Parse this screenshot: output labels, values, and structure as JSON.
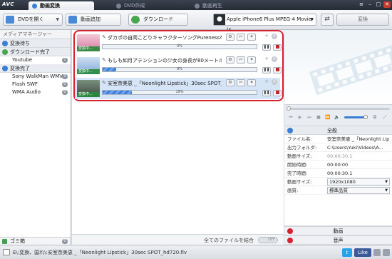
{
  "app": {
    "logo": "AVC"
  },
  "tabs": [
    {
      "label": "動画変換"
    },
    {
      "label": "DVD作成"
    },
    {
      "label": "動画再生"
    }
  ],
  "window_buttons": {
    "settings": "≡",
    "minimize": "–",
    "maximize": "□",
    "close": "✕"
  },
  "toolbar": {
    "open_dvd_label": "DVDを開く",
    "add_video_label": "動画追加",
    "download_label": "ダウンロード",
    "profile_value": "Apple iPhone6 Plus MPEG-4 Movie (*...",
    "convert_label": "変換"
  },
  "sidebar": {
    "header": "メディアマネージャー",
    "groups": [
      {
        "label": "変換待ち",
        "items": []
      },
      {
        "label": "ダウンロード完了",
        "items": [
          {
            "label": "Youtube",
            "count": "1"
          }
        ]
      },
      {
        "label": "変換完了",
        "items": [
          {
            "label": "Sony WalkMan WMV",
            "count": "0"
          },
          {
            "label": "Flash SWF",
            "count": "0"
          },
          {
            "label": "WMA Audio",
            "count": "0"
          }
        ]
      }
    ],
    "trash": {
      "label": "ゴミ箱",
      "count": "0"
    }
  },
  "files": [
    {
      "name": "ダカポの自両こどりキャラクターソングPureness卒...",
      "progress_pct": "0%",
      "progress": 0.0,
      "thumb_label": "変換中..."
    },
    {
      "name": "もしも如月アテンションの少女の身長が80メートル...",
      "progress_pct": "9%",
      "progress": 0.09,
      "thumb_label": "変換中..."
    },
    {
      "name": "安室奈美恵 _「Neonlight Lipstick」30sec SPOT_hd...",
      "progress_pct": "19%",
      "progress": 0.19,
      "thumb_label": "変換中..."
    }
  ],
  "merge": {
    "label": "全てのファイルを結合",
    "toggle": "OFF"
  },
  "properties": {
    "header": "全般",
    "rows": [
      {
        "key": "ファイル名:",
        "value": "安室奈美恵 _「Neonlight Lip"
      },
      {
        "key": "出力フォルダ:",
        "value": "C:\\Users\\Yuki\\Videos\\A..."
      },
      {
        "key": "動画サイズ:",
        "value": "00:00:30.1"
      },
      {
        "key": "開始時間:",
        "value": "00:00:00"
      },
      {
        "key": "完了時間:",
        "value": "00:00:30.1"
      },
      {
        "key": "動画サイズ:",
        "value": "1920x1080"
      },
      {
        "key": "画質:",
        "value": "標準品質"
      }
    ]
  },
  "sections": {
    "video": "動画",
    "audio": "音声"
  },
  "status": {
    "text": "E\\:変換、国れ\\:安室奈美恵 _「Neonlight Lipstick」30sec SPOT_hd720.flv",
    "twitter": "t",
    "facebook": "Like"
  },
  "colors": {
    "accent": "#3a7fd6",
    "highlight_border": "#d8202f",
    "selected_row": "#d6e4f7"
  }
}
